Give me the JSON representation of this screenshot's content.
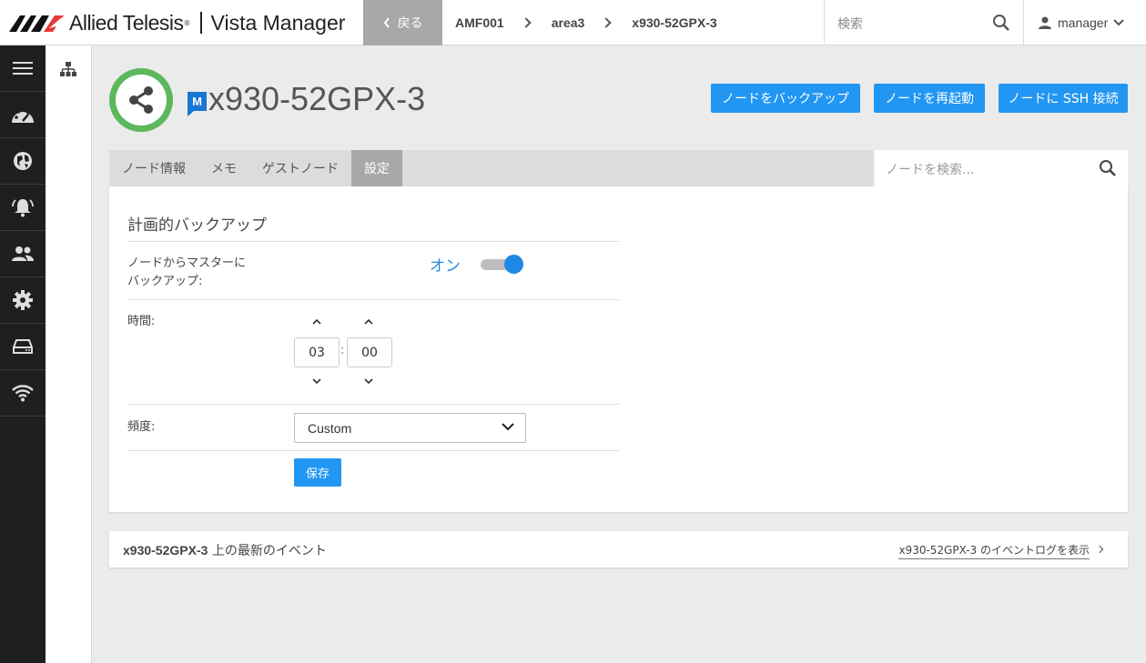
{
  "brand": {
    "company": "Allied Telesis",
    "product": "Vista Manager"
  },
  "header": {
    "back_label": "戻る",
    "breadcrumbs": [
      "AMF001",
      "area3",
      "x930-52GPX-3"
    ],
    "search_placeholder": "検索",
    "username": "manager"
  },
  "sidenav": {
    "items": [
      "menu-icon",
      "dashboard-icon",
      "globe-icon",
      "alarm-bell-icon",
      "users-icon",
      "gear-icon",
      "storage-icon",
      "wifi-icon"
    ]
  },
  "node": {
    "name": "x930-52GPX-3",
    "badge": "M",
    "status_color": "#5cb85c"
  },
  "actions": {
    "backup": "ノードをバックアップ",
    "reboot": "ノードを再起動",
    "ssh": "ノードに SSH 接続"
  },
  "tabs": [
    {
      "label": "ノード情報",
      "active": false
    },
    {
      "label": "メモ",
      "active": false
    },
    {
      "label": "ゲストノード",
      "active": false
    },
    {
      "label": "設定",
      "active": true
    }
  ],
  "node_search_placeholder": "ノードを検索...",
  "backup_settings": {
    "title": "計画的バックアップ",
    "node_to_master_label_line1": "ノードからマスターに",
    "node_to_master_label_line2": "バックアップ:",
    "toggle_state_text": "オン",
    "toggle_on": true,
    "time_label": "時間:",
    "hour": "03",
    "minute": "00",
    "time_separator": ":",
    "frequency_label": "頻度:",
    "frequency_value": "Custom",
    "save_label": "保存"
  },
  "events": {
    "title_node": "x930-52GPX-3",
    "title_suffix": " 上の最新のイベント",
    "link_label": "x930-52GPX-3 のイベントログを表示"
  },
  "colors": {
    "accent": "#2196f3",
    "sidebar_bg": "#1f1f1f",
    "active_tab": "#a8a8a8"
  }
}
